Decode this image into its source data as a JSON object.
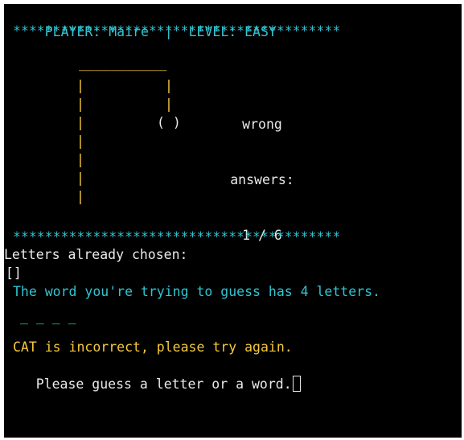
{
  "header": {
    "player_label": "PLAYER: Maire",
    "separator": "|",
    "level_label": "LEVEL: EASY"
  },
  "divider": "*****************************************",
  "gallows": {
    "beam": "___________",
    "post": "|",
    "rope": "|",
    "head": "( )"
  },
  "wrong_answers": {
    "line1": "wrong",
    "line2": "answers:",
    "count": "1 / 6"
  },
  "letters_chosen": {
    "label": "Letters already chosen:",
    "value": "[]"
  },
  "word_info": "The word you're trying to guess has 4 letters.",
  "word_blanks": "_ _ _ _",
  "feedback": "CAT is incorrect, please try again.",
  "prompt": "Please guess a letter or a word.",
  "colors": {
    "background": "#000000",
    "cyan": "#33c3d0",
    "yellow": "#f5c83c",
    "text": "#eaeaea"
  }
}
